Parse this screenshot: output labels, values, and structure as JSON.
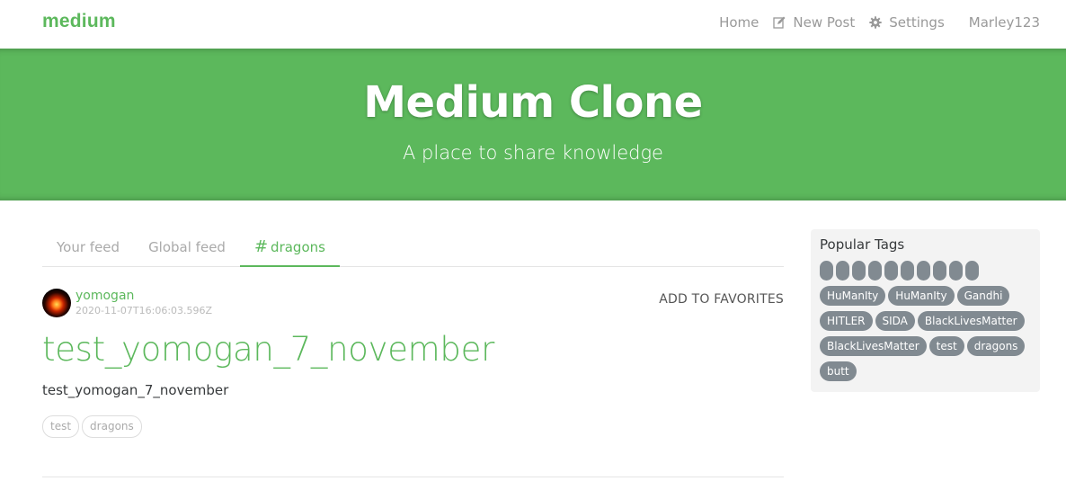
{
  "nav": {
    "brand": "medium",
    "home": "Home",
    "new_post": "New Post",
    "settings": "Settings",
    "user": "Marley123",
    "icons": {
      "new_post": "edit-icon",
      "settings": "gear-icon"
    }
  },
  "banner": {
    "title": "Medium Clone",
    "subtitle": "A place to share knowledge"
  },
  "feed": {
    "tabs": [
      {
        "label": "Your feed",
        "active": false
      },
      {
        "label": "Global feed",
        "active": false
      },
      {
        "label": "dragons",
        "active": true,
        "prefix": "#"
      }
    ]
  },
  "article": {
    "author": "yomogan",
    "date": "2020-11-07T16:06:03.596Z",
    "favorite_label": "ADD TO FAVORITES",
    "title": "test_yomogan_7_november",
    "description": "test_yomogan_7_november",
    "tags": [
      "test",
      "dragons"
    ]
  },
  "sidebar": {
    "title": "Popular Tags",
    "tags": [
      "",
      "",
      "",
      "",
      "",
      "",
      "",
      "",
      "",
      "",
      "HuManIty",
      "HuManIty",
      "Gandhi",
      "HITLER",
      "SIDA",
      "BlackLivesMatter",
      "BlackLivesMatter",
      "test",
      "dragons",
      "butt"
    ]
  },
  "colors": {
    "accent": "#5cb85c",
    "tag_pill": "#818a91",
    "sidebar_bg": "#f3f3f3"
  }
}
